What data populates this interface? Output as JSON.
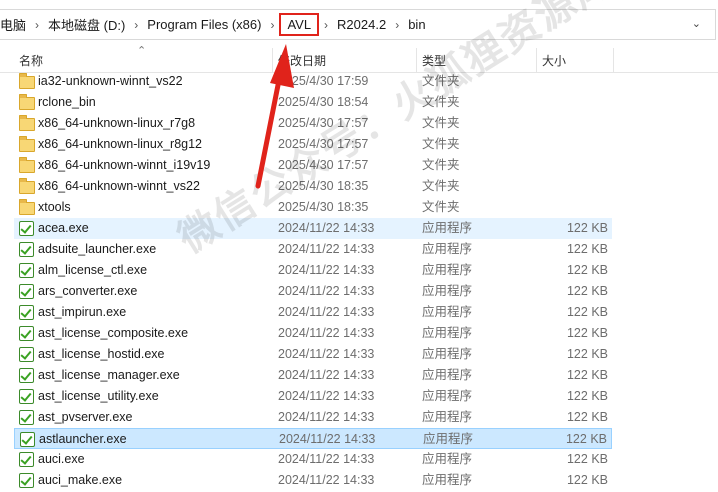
{
  "breadcrumb": {
    "items": [
      "电脑",
      "本地磁盘 (D:)",
      "Program Files (x86)",
      "AVL",
      "R2024.2",
      "bin"
    ],
    "separator": "›",
    "highlighted_index": 3
  },
  "columns": {
    "name": "名称",
    "date": "修改日期",
    "type": "类型",
    "size": "大小"
  },
  "rows": [
    {
      "name": "ia32-unknown-winnt_vs22",
      "date": "2025/4/30 17:59",
      "type": "文件夹",
      "size": "",
      "kind": "folder"
    },
    {
      "name": "rclone_bin",
      "date": "2025/4/30 18:54",
      "type": "文件夹",
      "size": "",
      "kind": "folder"
    },
    {
      "name": "x86_64-unknown-linux_r7g8",
      "date": "2025/4/30 17:57",
      "type": "文件夹",
      "size": "",
      "kind": "folder"
    },
    {
      "name": "x86_64-unknown-linux_r8g12",
      "date": "2025/4/30 17:57",
      "type": "文件夹",
      "size": "",
      "kind": "folder"
    },
    {
      "name": "x86_64-unknown-winnt_i19v19",
      "date": "2025/4/30 17:57",
      "type": "文件夹",
      "size": "",
      "kind": "folder"
    },
    {
      "name": "x86_64-unknown-winnt_vs22",
      "date": "2025/4/30 18:35",
      "type": "文件夹",
      "size": "",
      "kind": "folder"
    },
    {
      "name": "xtools",
      "date": "2025/4/30 18:35",
      "type": "文件夹",
      "size": "",
      "kind": "folder"
    },
    {
      "name": "acea.exe",
      "date": "2024/11/22 14:33",
      "type": "应用程序",
      "size": "122 KB",
      "kind": "exe",
      "state": "hover"
    },
    {
      "name": "adsuite_launcher.exe",
      "date": "2024/11/22 14:33",
      "type": "应用程序",
      "size": "122 KB",
      "kind": "exe"
    },
    {
      "name": "alm_license_ctl.exe",
      "date": "2024/11/22 14:33",
      "type": "应用程序",
      "size": "122 KB",
      "kind": "exe"
    },
    {
      "name": "ars_converter.exe",
      "date": "2024/11/22 14:33",
      "type": "应用程序",
      "size": "122 KB",
      "kind": "exe"
    },
    {
      "name": "ast_impirun.exe",
      "date": "2024/11/22 14:33",
      "type": "应用程序",
      "size": "122 KB",
      "kind": "exe"
    },
    {
      "name": "ast_license_composite.exe",
      "date": "2024/11/22 14:33",
      "type": "应用程序",
      "size": "122 KB",
      "kind": "exe"
    },
    {
      "name": "ast_license_hostid.exe",
      "date": "2024/11/22 14:33",
      "type": "应用程序",
      "size": "122 KB",
      "kind": "exe"
    },
    {
      "name": "ast_license_manager.exe",
      "date": "2024/11/22 14:33",
      "type": "应用程序",
      "size": "122 KB",
      "kind": "exe"
    },
    {
      "name": "ast_license_utility.exe",
      "date": "2024/11/22 14:33",
      "type": "应用程序",
      "size": "122 KB",
      "kind": "exe"
    },
    {
      "name": "ast_pvserver.exe",
      "date": "2024/11/22 14:33",
      "type": "应用程序",
      "size": "122 KB",
      "kind": "exe"
    },
    {
      "name": "astlauncher.exe",
      "date": "2024/11/22 14:33",
      "type": "应用程序",
      "size": "122 KB",
      "kind": "exe",
      "state": "selected"
    },
    {
      "name": "auci.exe",
      "date": "2024/11/22 14:33",
      "type": "应用程序",
      "size": "122 KB",
      "kind": "exe"
    },
    {
      "name": "auci_make.exe",
      "date": "2024/11/22 14:33",
      "type": "应用程序",
      "size": "122 KB",
      "kind": "exe"
    }
  ],
  "watermark": "微信公众号：火狐狸资源库",
  "colors": {
    "highlight_box": "#e0231b",
    "arrow": "#e0231b",
    "selection": "#cce8ff",
    "hover": "#e5f3ff"
  },
  "icons": {
    "folder": "folder-icon",
    "exe": "application-exe-icon",
    "sort": "sort-up-icon",
    "dropdown": "chevron-down-icon"
  }
}
